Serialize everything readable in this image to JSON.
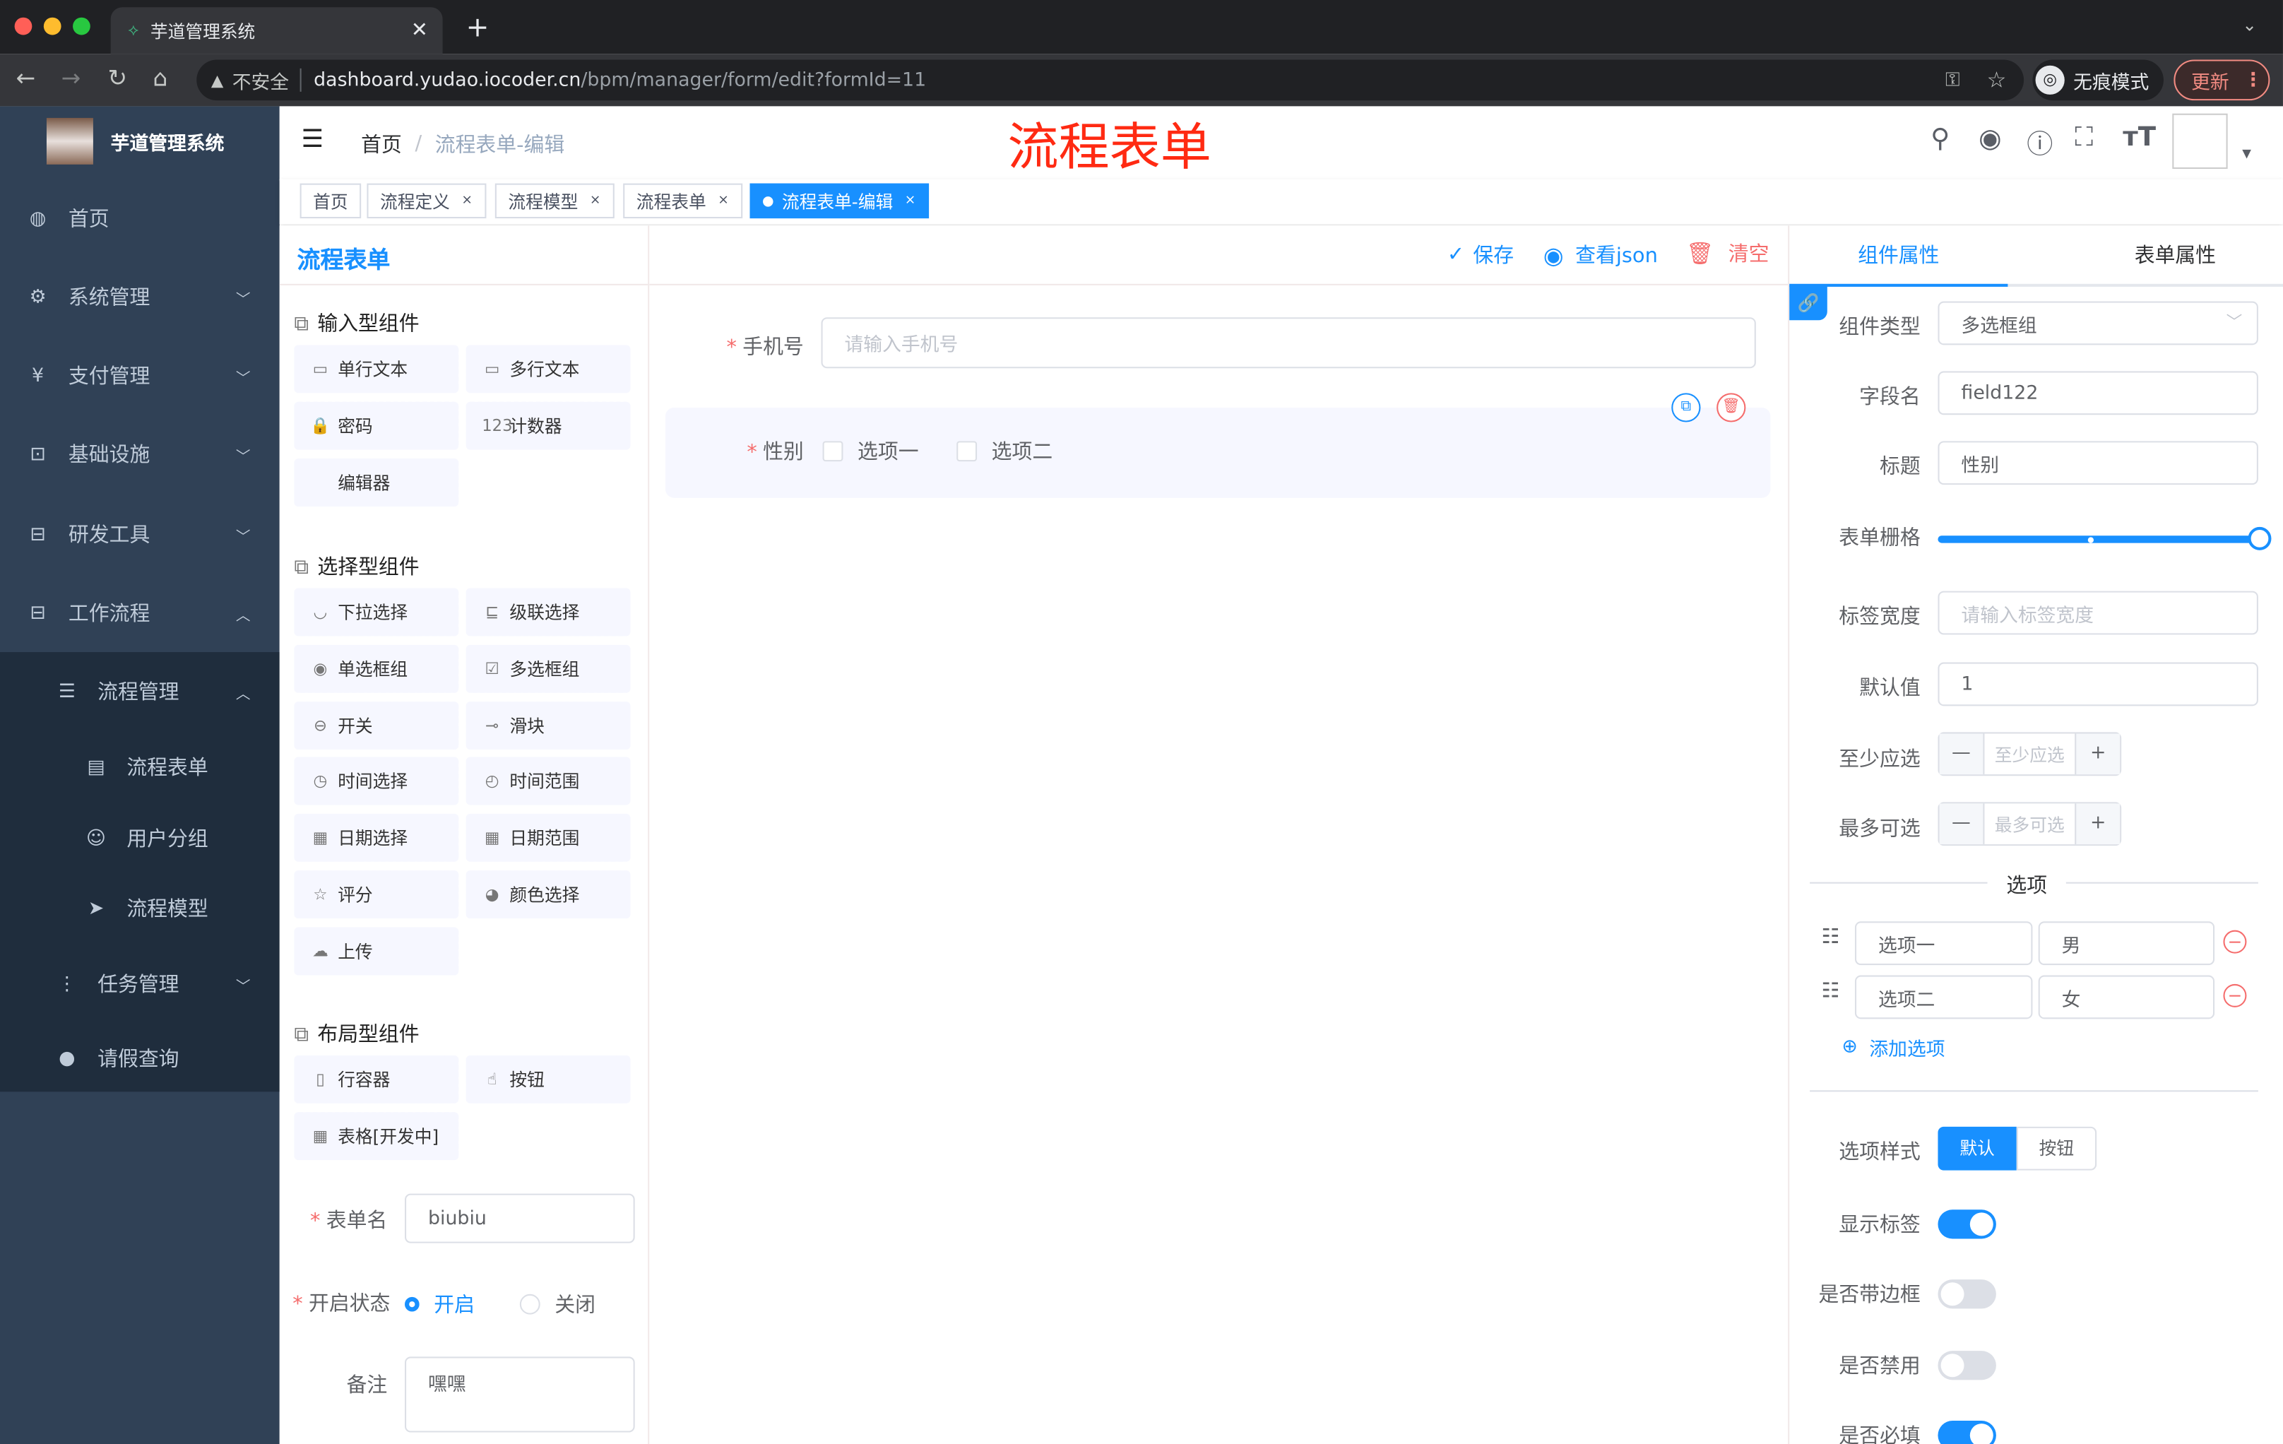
{
  "browser": {
    "tab_title": "芋道管理系统",
    "new_tab": "+",
    "security": "不安全",
    "url_host": "dashboard.yudao.iocoder.cn",
    "url_path": "/bpm/manager/form/edit?formId=11",
    "incognito": "无痕模式",
    "update": "更新"
  },
  "sidebar": {
    "logo_title": "芋道管理系统",
    "items": [
      {
        "label": "首页",
        "icon": "dashboard-icon"
      },
      {
        "label": "系统管理",
        "icon": "gear-icon"
      },
      {
        "label": "支付管理",
        "icon": "yen-icon"
      },
      {
        "label": "基础设施",
        "icon": "monitor-icon"
      },
      {
        "label": "研发工具",
        "icon": "toolbox-icon"
      },
      {
        "label": "工作流程",
        "icon": "toolbox-icon"
      },
      {
        "label": "流程管理",
        "icon": "list-icon"
      },
      {
        "label": "流程表单",
        "icon": "form-icon"
      },
      {
        "label": "用户分组",
        "icon": "people-icon"
      },
      {
        "label": "流程模型",
        "icon": "send-icon"
      },
      {
        "label": "任务管理",
        "icon": "tree-icon"
      },
      {
        "label": "请假查询",
        "icon": "user-icon"
      }
    ]
  },
  "header": {
    "breadcrumb_home": "首页",
    "breadcrumb_sep": "/",
    "breadcrumb_current": "流程表单-编辑",
    "overlay_title": "流程表单"
  },
  "tags": [
    {
      "label": "首页"
    },
    {
      "label": "流程定义",
      "close": "×"
    },
    {
      "label": "流程模型",
      "close": "×"
    },
    {
      "label": "流程表单",
      "close": "×"
    },
    {
      "label": "流程表单-编辑",
      "close": "×",
      "active": true
    }
  ],
  "left_panel": {
    "title": "流程表单",
    "groups": [
      {
        "title": "输入型组件",
        "items": [
          "单行文本",
          "多行文本",
          "密码",
          "计数器",
          "编辑器"
        ]
      },
      {
        "title": "选择型组件",
        "items": [
          "下拉选择",
          "级联选择",
          "单选框组",
          "多选框组",
          "开关",
          "滑块",
          "时间选择",
          "时间范围",
          "日期选择",
          "日期范围",
          "评分",
          "颜色选择",
          "上传"
        ]
      },
      {
        "title": "布局型组件",
        "items": [
          "行容器",
          "按钮",
          "表格[开发中]"
        ]
      }
    ],
    "form_name_label": "表单名",
    "form_name_value": "biubiu",
    "status_label": "开启状态",
    "status_on": "开启",
    "status_off": "关闭",
    "remark_label": "备注",
    "remark_value": "嘿嘿"
  },
  "toolbar": {
    "save": "保存",
    "view_json": "查看json",
    "clear": "清空"
  },
  "canvas": {
    "phone_label": "手机号",
    "phone_placeholder": "请输入手机号",
    "gender_label": "性别",
    "option1": "选项一",
    "option2": "选项二"
  },
  "right_panel": {
    "tab_component": "组件属性",
    "tab_form": "表单属性",
    "type_label": "组件类型",
    "type_value": "多选框组",
    "field_label": "字段名",
    "field_value": "field122",
    "title_label": "标题",
    "title_value": "性别",
    "grid_label": "表单栅格",
    "grid_value": 24,
    "label_width_label": "标签宽度",
    "label_width_placeholder": "请输入标签宽度",
    "default_label": "默认值",
    "default_value": "1",
    "min_label": "至少应选",
    "min_placeholder": "至少应选",
    "max_label": "最多可选",
    "max_placeholder": "最多可选",
    "stepper_minus": "—",
    "stepper_plus": "+",
    "options_divider": "选项",
    "options": [
      {
        "label": "选项一",
        "value": "男"
      },
      {
        "label": "选项二",
        "value": "女"
      }
    ],
    "add_option": "添加选项",
    "style_label": "选项样式",
    "style_default": "默认",
    "style_button": "按钮",
    "show_label_label": "显示标签",
    "show_label": true,
    "border_label": "是否带边框",
    "border": false,
    "disabled_label": "是否禁用",
    "disabled": false,
    "required_label": "是否必填",
    "required": true
  },
  "colors": {
    "primary": "#1890ff",
    "sidebar": "#304156",
    "sidebar_sub": "#1f2d3d",
    "danger": "#f56c6c",
    "title_red": "#ff2a12"
  }
}
